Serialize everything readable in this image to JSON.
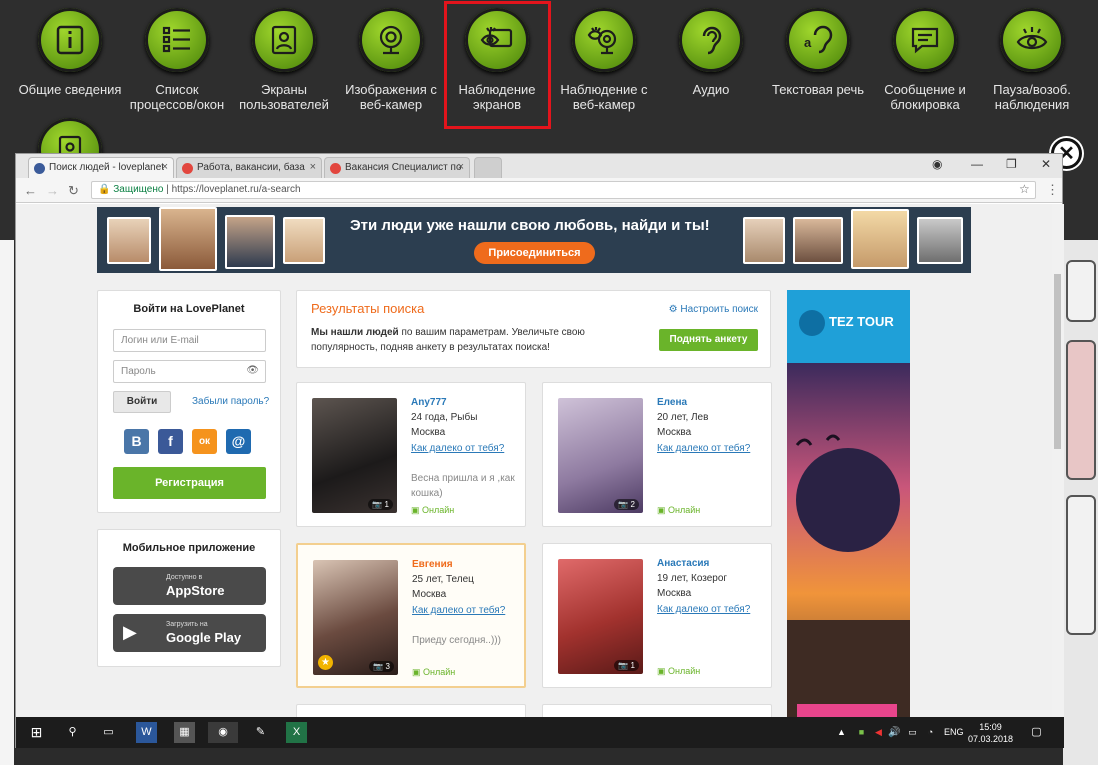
{
  "toolbar": {
    "items": [
      {
        "label": "Общие сведения",
        "icon": "info-icon"
      },
      {
        "label": "Список процессов/окон",
        "icon": "list-icon"
      },
      {
        "label": "Экраны пользователей",
        "icon": "user-screen-icon"
      },
      {
        "label": "Изображения с веб-камер",
        "icon": "webcam-icon"
      },
      {
        "label": "Наблюдение экранов",
        "icon": "eye-screen-icon"
      },
      {
        "label": "Наблюдение с веб-камер",
        "icon": "eye-webcam-icon"
      },
      {
        "label": "Аудио",
        "icon": "ear-icon"
      },
      {
        "label": "Текстовая речь",
        "icon": "ear-text-icon"
      },
      {
        "label": "Сообщение и блокировка",
        "icon": "message-icon"
      },
      {
        "label": "Пауза/возоб. наблюдения",
        "icon": "pause-eye-icon"
      }
    ],
    "accent": "#7fbf1e",
    "highlight_color": "#e3141c"
  },
  "browser": {
    "tabs": [
      {
        "title": "Поиск людей - loveplanet",
        "active": true
      },
      {
        "title": "Работа, вакансии, база",
        "active": false
      },
      {
        "title": "Вакансия Специалист по",
        "active": false
      }
    ],
    "secure_label": "Защищено",
    "url": "https://loveplanet.ru/a-search"
  },
  "banner": {
    "text": "Эти люди уже нашли свою любовь, найди и ты!",
    "join_label": "Присоединиться"
  },
  "login": {
    "title": "Войти на LovePlanet",
    "login_placeholder": "Логин или E-mail",
    "password_placeholder": "Пароль",
    "enter_label": "Войти",
    "forgot_label": "Забыли пароль?",
    "register_label": "Регистрация",
    "social": [
      "В",
      "f",
      "ок",
      "@"
    ]
  },
  "mobile": {
    "title": "Мобильное приложение",
    "appstore_small": "Доступно в",
    "appstore_big": "AppStore",
    "googleplay_small": "Загрузить на",
    "googleplay_big": "Google Play"
  },
  "results": {
    "title": "Результаты поиска",
    "settings": "Настроить поиск",
    "text_bold": "Мы нашли людей",
    "text_rest": " по вашим параметрам. Увеличьте свою популярность, подняв анкету в результатах поиска!",
    "lift_label": "Поднять анкету"
  },
  "profiles": [
    {
      "name": "Any777",
      "age": "24 года, Рыбы",
      "city": "Москва",
      "distance": "Как далеко от тебя?",
      "status": "Весна пришла и я ,как кошка)",
      "online": "Онлайн",
      "photos": "1",
      "featured": false
    },
    {
      "name": "Елена",
      "age": "20 лет, Лев",
      "city": "Москва",
      "distance": "Как далеко от тебя?",
      "status": "",
      "online": "Онлайн",
      "photos": "2",
      "featured": false
    },
    {
      "name": "Евгения",
      "age": "25 лет, Телец",
      "city": "Москва",
      "distance": "Как далеко от тебя?",
      "status": "Приеду сегодня..)))",
      "online": "Онлайн",
      "photos": "3",
      "featured": true
    },
    {
      "name": "Анастасия",
      "age": "19 лет, Козерог",
      "city": "Москва",
      "distance": "Как далеко от тебя?",
      "status": "",
      "online": "Онлайн",
      "photos": "1",
      "featured": false
    }
  ],
  "ad": {
    "brand": "TEZ TOUR"
  },
  "taskbar": {
    "lang": "ENG",
    "time": "15:09",
    "date": "07.03.2018"
  }
}
